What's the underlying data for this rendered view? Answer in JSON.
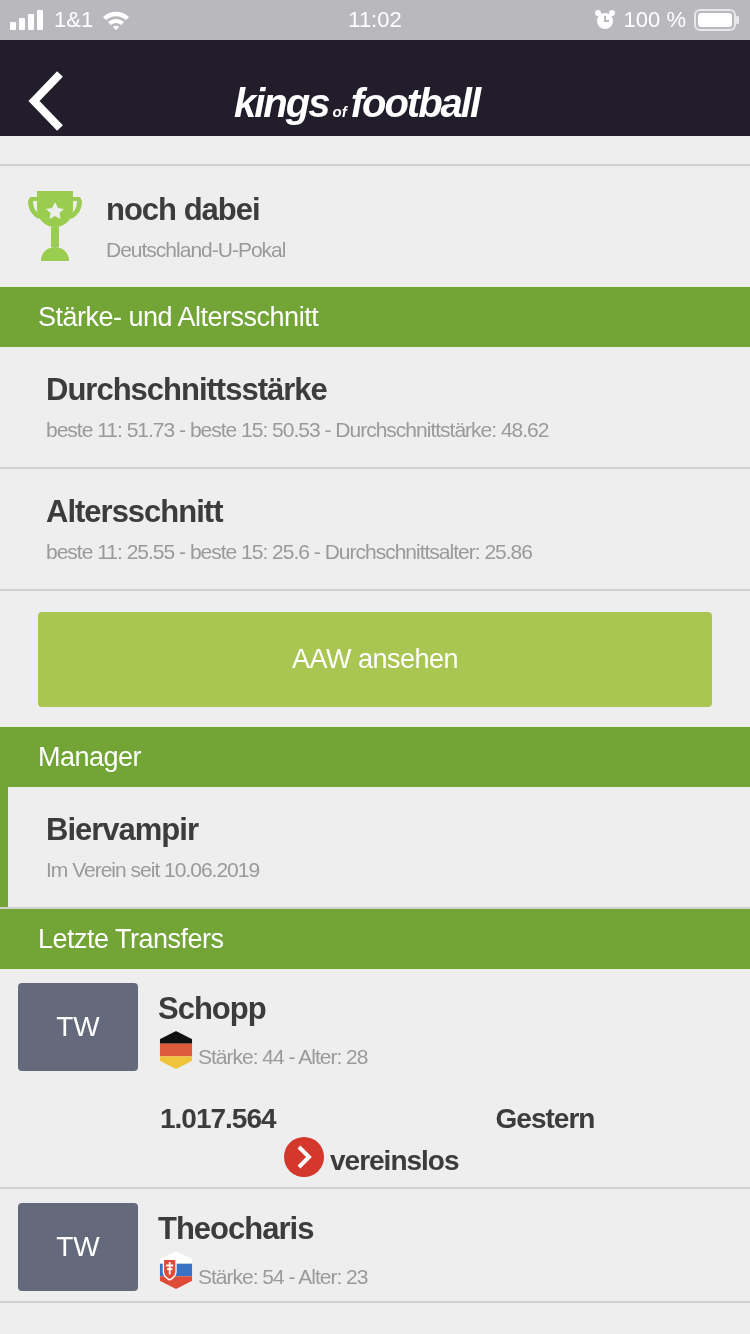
{
  "status_bar": {
    "carrier": "1&1",
    "time": "11:02",
    "battery": "100 %"
  },
  "nav": {
    "logo": {
      "first": "kings",
      "middle": "of",
      "last": "football"
    }
  },
  "cup": {
    "title": "noch dabei",
    "subtitle": "Deutschland-U-Pokal"
  },
  "sections": [
    {
      "kind": "stats",
      "header": "Stärke- und Altersschnitt",
      "rows": [
        {
          "title": "Durchschnittsstärke",
          "subtitle": "beste 11: 51.73 - beste 15: 50.53 - Durchschnittstärke: 48.62"
        },
        {
          "title": "Altersschnitt",
          "subtitle": "beste 11: 25.55 - beste 15: 25.6 - Durchschnittsalter: 25.86"
        }
      ],
      "button": "AAW ansehen"
    },
    {
      "kind": "manager",
      "header": "Manager",
      "rows": [
        {
          "title": "Biervampir",
          "subtitle": "Im Verein seit 10.06.2019",
          "accent": true
        }
      ]
    },
    {
      "kind": "transfers",
      "header": "Letzte Transfers",
      "transfers": [
        {
          "position": "TW",
          "name": "Schopp",
          "flag": {
            "kind": "germany"
          },
          "info": "Stärke: 44 - Alter: 28",
          "fee": "1.017.564",
          "date": "Gestern",
          "destination": "vereinslos"
        },
        {
          "position": "TW",
          "name": "Theocharis",
          "flag": {
            "kind": "slovakia"
          },
          "info": "Stärke: 54 - Alter: 23"
        }
      ]
    }
  ]
}
